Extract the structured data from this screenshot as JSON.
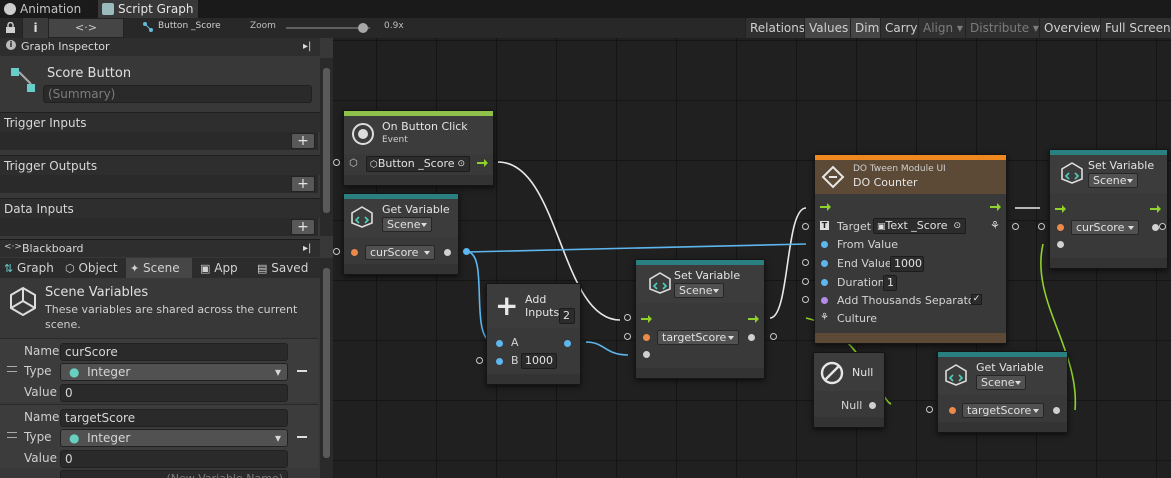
{
  "tabs": {
    "animation": "Animation",
    "script_graph": "Script Graph"
  },
  "toolbar": {
    "breadcrumb": "Button _Score",
    "zoom_label": "Zoom",
    "zoom_value": "0.9x",
    "buttons": [
      "Relations",
      "Values",
      "Dim",
      "Carry",
      "Align",
      "Distribute",
      "Overview",
      "Full Screen"
    ]
  },
  "inspector": {
    "title": "Graph Inspector",
    "graph_name": "Score Button",
    "summary_placeholder": "(Summary)",
    "trigger_inputs": "Trigger Inputs",
    "trigger_outputs": "Trigger Outputs",
    "data_inputs": "Data Inputs"
  },
  "blackboard": {
    "title": "Blackboard",
    "tabs": [
      "Graph",
      "Object",
      "Scene",
      "App",
      "Saved"
    ],
    "section_title": "Scene Variables",
    "section_desc": "These variables are shared across the current scene.",
    "variables": [
      {
        "name_label": "Name",
        "name": "curScore",
        "type_label": "Type",
        "type": "Integer",
        "value_label": "Value",
        "value": "0"
      },
      {
        "name_label": "Name",
        "name": "targetScore",
        "type_label": "Type",
        "type": "Integer",
        "value_label": "Value",
        "value": "0"
      }
    ],
    "new_variable_placeholder": "(New Variable Name)"
  },
  "nodes": {
    "on_click": {
      "title": "On Button Click",
      "subtitle": "Event",
      "target": "Button _Score"
    },
    "get_var_1": {
      "title": "Get Variable",
      "scope": "Scene",
      "var": "curScore"
    },
    "add": {
      "title": "Add Inputs",
      "count": "2",
      "a": "A",
      "b": "B",
      "b_value": "1000"
    },
    "set_var_1": {
      "title": "Set Variable",
      "scope": "Scene",
      "var": "targetScore"
    },
    "dotween": {
      "category": "DO Tween Module UI",
      "title": "DO Counter",
      "target_label": "Target",
      "target_value": "Text _Score",
      "from_label": "From Value",
      "end_label": "End Value",
      "end_value": "1000",
      "duration_label": "Duration",
      "duration_value": "1",
      "sep_label": "Add Thousands Separator",
      "culture_label": "Culture"
    },
    "set_var_2": {
      "title": "Set Variable",
      "scope": "Scene",
      "var": "curScore"
    },
    "null": {
      "title": "Null",
      "out": "Null"
    },
    "get_var_2": {
      "title": "Get Variable",
      "scope": "Scene",
      "var": "targetScore"
    }
  },
  "colors": {
    "event_green": "#8ec24a",
    "teal": "#2a7f80",
    "dotween_orange": "#f08820",
    "blue_wire": "#5eb6ee",
    "green_wire": "#8ed22a"
  }
}
